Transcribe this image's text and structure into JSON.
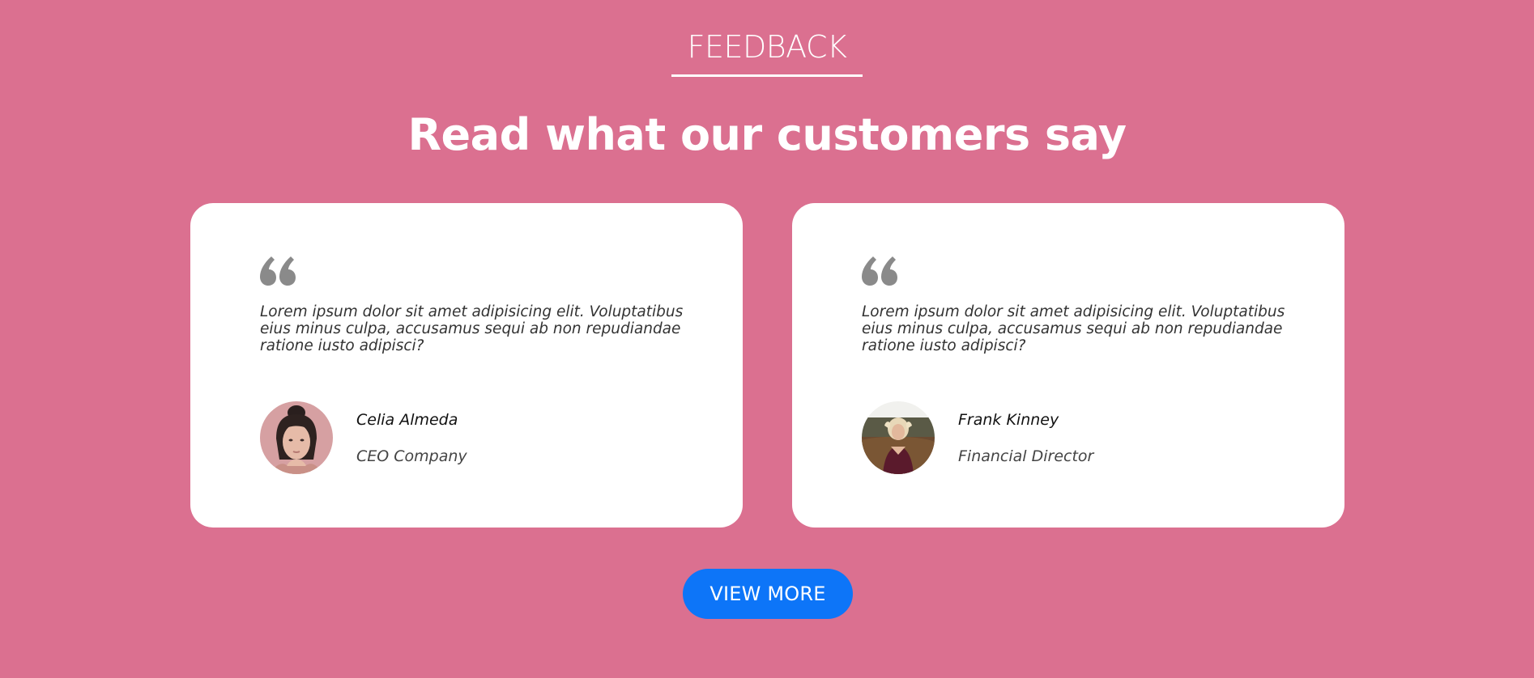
{
  "section": {
    "eyebrow": "FEEDBACK",
    "headline": "Read what our customers say"
  },
  "testimonials": [
    {
      "quote": "Lorem ipsum dolor sit amet adipisicing elit. Voluptatibus eius minus culpa, accusamus sequi ab non repudiandae ratione iusto adipisci?",
      "name": "Celia Almeda",
      "role": "CEO Company"
    },
    {
      "quote": "Lorem ipsum dolor sit amet adipisicing elit. Voluptatibus eius minus culpa, accusamus sequi ab non repudiandae ratione iusto adipisci?",
      "name": "Frank Kinney",
      "role": "Financial Director"
    }
  ],
  "cta": {
    "label": "VIEW MORE"
  },
  "icons": {
    "quote": "quote-icon"
  },
  "colors": {
    "background": "#db7090",
    "card": "#ffffff",
    "button": "#0d75f8",
    "quote_icon": "#8a8a8a"
  }
}
